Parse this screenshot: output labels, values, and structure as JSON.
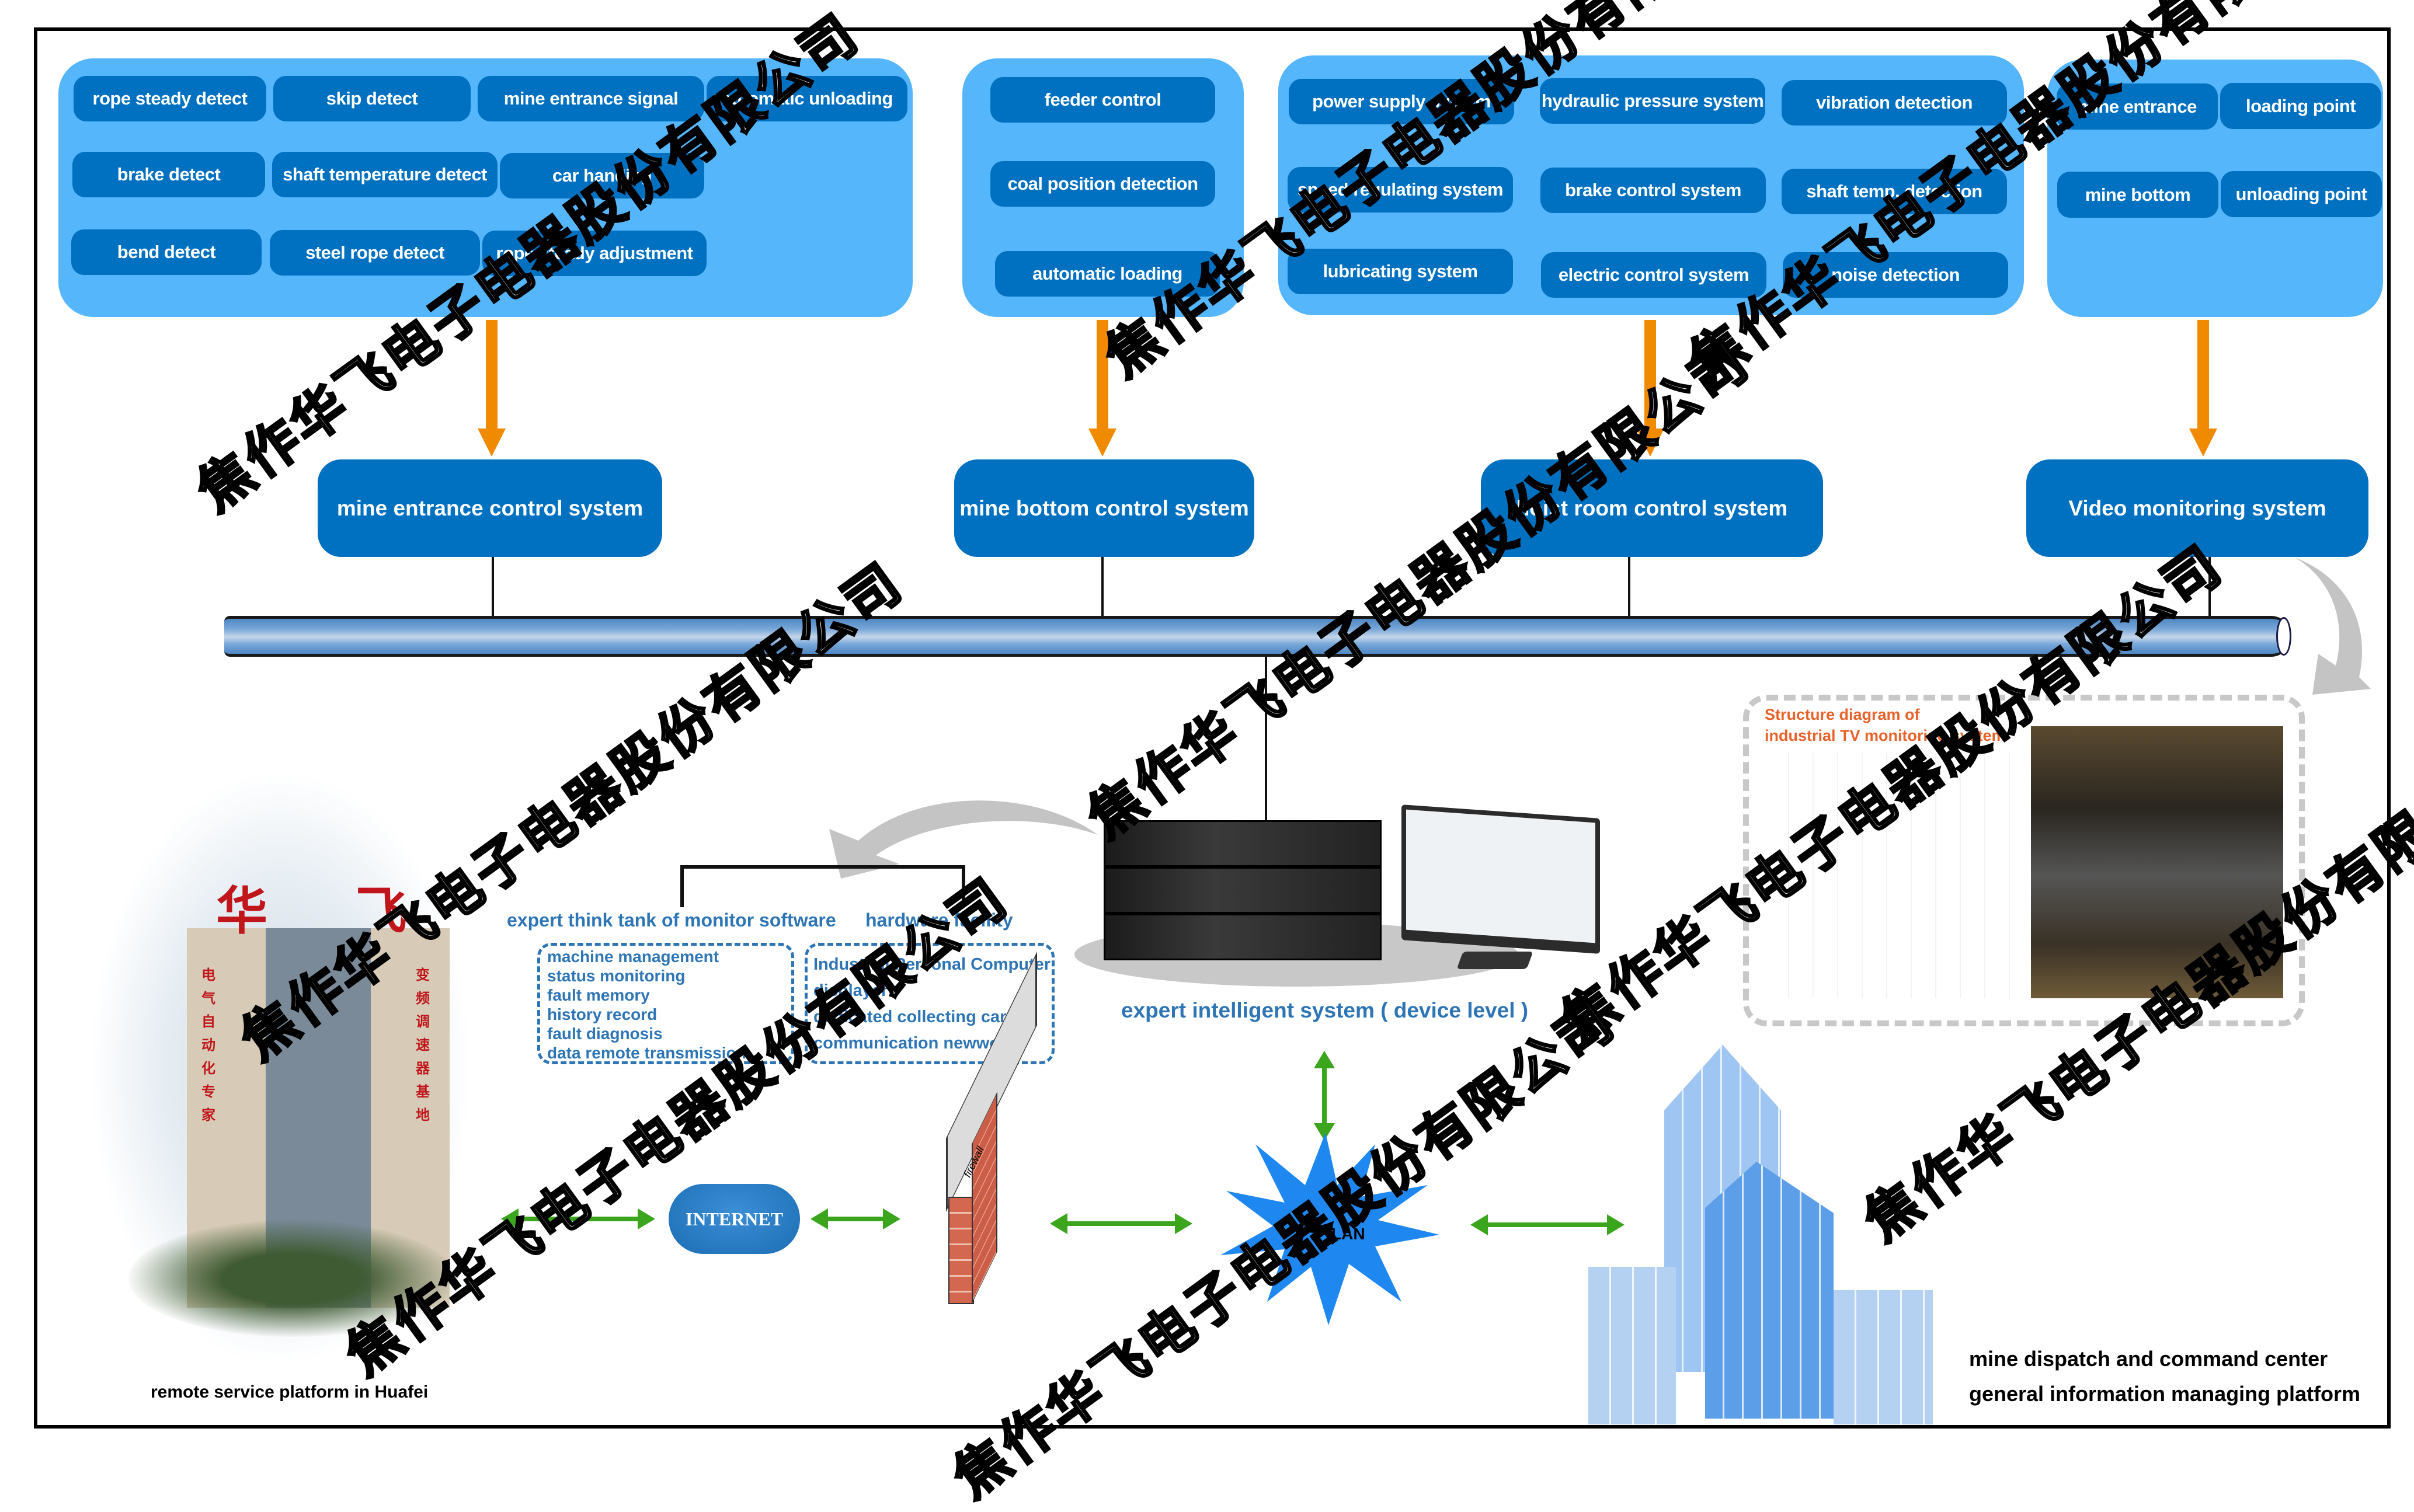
{
  "groups": {
    "mine_entrance": {
      "items": [
        "rope steady detect",
        "skip detect",
        "mine entrance signal",
        "automatic unloading",
        "brake detect",
        "shaft temperature detect",
        "car handing",
        "bend detect",
        "steel rope detect",
        "rope steady adjustment"
      ]
    },
    "mine_bottom": {
      "items": [
        "feeder control",
        "coal position detection",
        "automatic loading"
      ]
    },
    "hoist_room": {
      "items": [
        "power supply system",
        "hydraulic pressure system",
        "vibration detection",
        "speed regulating system",
        "brake control system",
        "shaft temp. detection",
        "lubricating system",
        "electric control system",
        "noise detection"
      ]
    },
    "video": {
      "items": [
        "mine entrance",
        "loading point",
        "mine bottom",
        "unloading point"
      ]
    }
  },
  "systems": [
    "mine entrance control system",
    "mine bottom control system",
    "hoist room control system",
    "Video monitoring system"
  ],
  "expert": {
    "software_title": "expert think tank of monitor software",
    "hardware_title": "hardware facility",
    "software_items": [
      "machine management",
      "status monitoring",
      "fault memory",
      "history record",
      "fault diagnosis",
      "data remote transmission"
    ],
    "hardware_items": [
      "Industrial Personal Computer",
      "displayer",
      "dedicated collecting card",
      "communication newwork"
    ],
    "device_caption": "expert intelligent system ( device level )"
  },
  "tv_monitoring": {
    "title_line1": "Structure diagram of",
    "title_line2": "industrial TV monitoring system"
  },
  "network": {
    "internet_label": "INTERNET",
    "firewall_label": "firewall",
    "lan_label": "LAN"
  },
  "huafei": {
    "caption": "remote service platform in Huafei",
    "sign": "华 飞",
    "left_slogan": "电气自动化专家",
    "right_slogan": "变频调速器基地"
  },
  "dispatch": {
    "line1": "mine dispatch and command center",
    "line2": "general information managing platform"
  },
  "watermark": "焦作华飞电子电器股份有限公司",
  "colors": {
    "group_bg": "#55b6fc",
    "chip_bg": "#0070c0",
    "arrow_orange": "#f08a00",
    "arrow_green": "#3ba61d",
    "text_blue": "#2e75b6",
    "tv_title": "#e8622a"
  }
}
